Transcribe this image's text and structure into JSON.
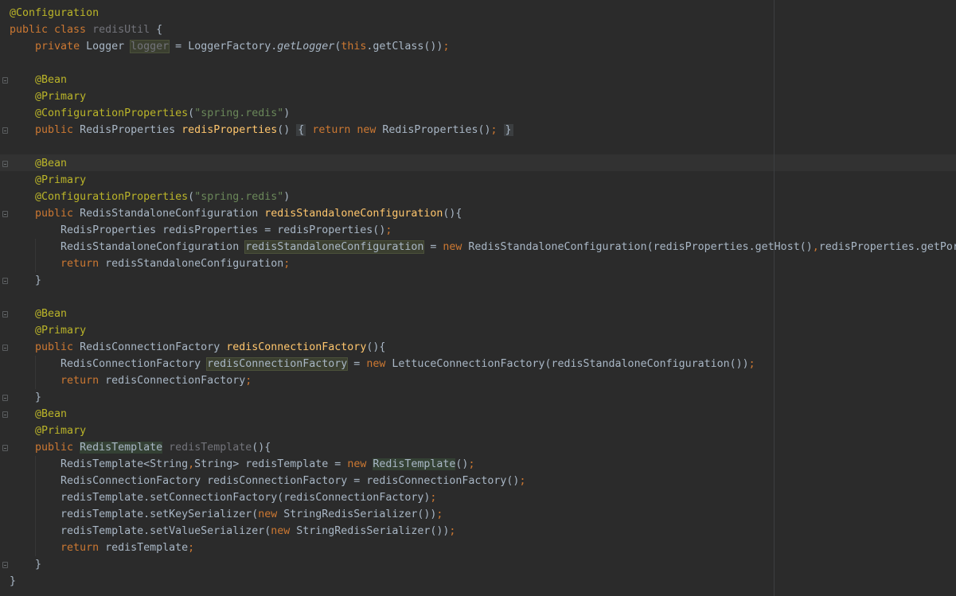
{
  "editor": {
    "active_line": 9,
    "lines": [
      [
        {
          "t": "@Configuration",
          "c": "ann"
        }
      ],
      [
        {
          "t": "public class ",
          "c": "kw"
        },
        {
          "t": "redisUtil",
          "c": "unused"
        },
        {
          "t": " {"
        }
      ],
      [
        {
          "t": "    "
        },
        {
          "t": "private ",
          "c": "kw"
        },
        {
          "t": "Logger "
        },
        {
          "t": "logger",
          "c": "unused hl"
        },
        {
          "t": " = LoggerFactory."
        },
        {
          "t": "getLogger",
          "c": "it"
        },
        {
          "t": "("
        },
        {
          "t": "this",
          "c": "kw"
        },
        {
          "t": ".getClass())"
        },
        {
          "t": ";",
          "c": "kw"
        }
      ],
      [],
      [
        {
          "t": "    "
        },
        {
          "t": "@Bean",
          "c": "ann"
        }
      ],
      [
        {
          "t": "    "
        },
        {
          "t": "@Primary",
          "c": "ann"
        }
      ],
      [
        {
          "t": "    "
        },
        {
          "t": "@ConfigurationProperties",
          "c": "ann"
        },
        {
          "t": "("
        },
        {
          "t": "\"spring.redis\"",
          "c": "str"
        },
        {
          "t": ")"
        }
      ],
      [
        {
          "t": "    "
        },
        {
          "t": "public ",
          "c": "kw"
        },
        {
          "t": "RedisProperties "
        },
        {
          "t": "redisProperties",
          "c": "fn"
        },
        {
          "t": "() "
        },
        {
          "t": "{",
          "c": "fold-chip"
        },
        {
          "t": " "
        },
        {
          "t": "return new ",
          "c": "kw"
        },
        {
          "t": "RedisProperties()"
        },
        {
          "t": ";",
          "c": "kw"
        },
        {
          "t": " "
        },
        {
          "t": "}",
          "c": "fold-chip"
        }
      ],
      [],
      [
        {
          "t": "    "
        },
        {
          "t": "@Bean",
          "c": "ann"
        }
      ],
      [
        {
          "t": "    "
        },
        {
          "t": "@Primary",
          "c": "ann"
        }
      ],
      [
        {
          "t": "    "
        },
        {
          "t": "@ConfigurationProperties",
          "c": "ann"
        },
        {
          "t": "("
        },
        {
          "t": "\"spring.redis\"",
          "c": "str"
        },
        {
          "t": ")"
        }
      ],
      [
        {
          "t": "    "
        },
        {
          "t": "public ",
          "c": "kw"
        },
        {
          "t": "RedisStandaloneConfiguration "
        },
        {
          "t": "redisStandaloneConfiguration",
          "c": "fn"
        },
        {
          "t": "(){"
        }
      ],
      [
        {
          "t": "        RedisProperties redisProperties = redisProperties()"
        },
        {
          "t": ";",
          "c": "kw"
        }
      ],
      [
        {
          "t": "        RedisStandaloneConfiguration "
        },
        {
          "t": "redisStandaloneConfiguration",
          "c": "hl"
        },
        {
          "t": " = "
        },
        {
          "t": "new ",
          "c": "kw"
        },
        {
          "t": "RedisStandaloneConfiguration(redisProperties.getHost()"
        },
        {
          "t": ",",
          "c": "kw"
        },
        {
          "t": "redisProperties.getPort"
        }
      ],
      [
        {
          "t": "        "
        },
        {
          "t": "return ",
          "c": "kw"
        },
        {
          "t": "redisStandaloneConfiguration"
        },
        {
          "t": ";",
          "c": "kw"
        }
      ],
      [
        {
          "t": "    }"
        }
      ],
      [],
      [
        {
          "t": "    "
        },
        {
          "t": "@Bean",
          "c": "ann"
        }
      ],
      [
        {
          "t": "    "
        },
        {
          "t": "@Primary",
          "c": "ann"
        }
      ],
      [
        {
          "t": "    "
        },
        {
          "t": "public ",
          "c": "kw"
        },
        {
          "t": "RedisConnectionFactory "
        },
        {
          "t": "redisConnectionFactory",
          "c": "fn"
        },
        {
          "t": "(){"
        }
      ],
      [
        {
          "t": "        RedisConnectionFactory "
        },
        {
          "t": "redisConnectionFactory",
          "c": "hl"
        },
        {
          "t": " = "
        },
        {
          "t": "new ",
          "c": "kw"
        },
        {
          "t": "LettuceConnectionFactory(redisStandaloneConfiguration())"
        },
        {
          "t": ";",
          "c": "kw"
        }
      ],
      [
        {
          "t": "        "
        },
        {
          "t": "return ",
          "c": "kw"
        },
        {
          "t": "redisConnectionFactory"
        },
        {
          "t": ";",
          "c": "kw"
        }
      ],
      [
        {
          "t": "    }"
        }
      ],
      [
        {
          "t": "    "
        },
        {
          "t": "@Bean",
          "c": "ann"
        }
      ],
      [
        {
          "t": "    "
        },
        {
          "t": "@Primary",
          "c": "ann"
        }
      ],
      [
        {
          "t": "    "
        },
        {
          "t": "public ",
          "c": "kw"
        },
        {
          "t": "RedisTemplate",
          "c": "hl2"
        },
        {
          "t": " "
        },
        {
          "t": "redisTemplate",
          "c": "unused"
        },
        {
          "t": "(){"
        }
      ],
      [
        {
          "t": "        RedisTemplate<String"
        },
        {
          "t": ",",
          "c": "kw"
        },
        {
          "t": "String> redisTemplate = "
        },
        {
          "t": "new ",
          "c": "kw"
        },
        {
          "t": "RedisTemplate",
          "c": "hl2"
        },
        {
          "t": "()"
        },
        {
          "t": ";",
          "c": "kw"
        }
      ],
      [
        {
          "t": "        RedisConnectionFactory redisConnectionFactory = redisConnectionFactory()"
        },
        {
          "t": ";",
          "c": "kw"
        }
      ],
      [
        {
          "t": "        redisTemplate.setConnectionFactory(redisConnectionFactory)"
        },
        {
          "t": ";",
          "c": "kw"
        }
      ],
      [
        {
          "t": "        redisTemplate.setKeySerializer("
        },
        {
          "t": "new ",
          "c": "kw"
        },
        {
          "t": "StringRedisSerializer())"
        },
        {
          "t": ";",
          "c": "kw"
        }
      ],
      [
        {
          "t": "        redisTemplate.setValueSerializer("
        },
        {
          "t": "new ",
          "c": "kw"
        },
        {
          "t": "StringRedisSerializer())"
        },
        {
          "t": ";",
          "c": "kw"
        }
      ],
      [
        {
          "t": "        "
        },
        {
          "t": "return ",
          "c": "kw"
        },
        {
          "t": "redisTemplate"
        },
        {
          "t": ";",
          "c": "kw"
        }
      ],
      [
        {
          "t": "    }"
        }
      ],
      [
        {
          "t": "}"
        }
      ]
    ],
    "fold_markers": [
      4,
      7,
      9,
      12,
      16,
      18,
      20,
      23,
      24,
      26,
      33
    ]
  }
}
